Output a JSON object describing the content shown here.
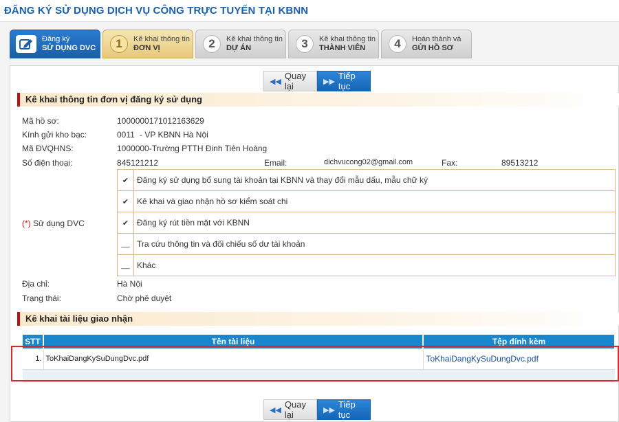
{
  "page": {
    "title": "ĐĂNG KÝ SỬ DỤNG DỊCH VỤ CÔNG TRỰC TUYẾN TẠI KBNN"
  },
  "tabs": [
    {
      "line1": "Đăng ký",
      "line2": "SỬ DỤNG DVC",
      "icon": "edit-icon"
    },
    {
      "number": "1",
      "line1": "Kê khai thông tin",
      "line2": "ĐƠN VỊ"
    },
    {
      "number": "2",
      "line1": "Kê khai thông tin",
      "line2": "DỰ ÁN"
    },
    {
      "number": "3",
      "line1": "Kê khai thông tin",
      "line2": "THÀNH VIÊN"
    },
    {
      "number": "4",
      "line1": "Hoàn thành và",
      "line2": "GỬI HỒ SƠ"
    }
  ],
  "actions": {
    "back_label": "Quay lại",
    "next_label": "Tiếp tục"
  },
  "unit_section": {
    "title": "Kê khai thông tin đơn vị đăng ký sử dụng",
    "ma_ho_so_label": "Mã hồ sơ:",
    "ma_ho_so": "1000000171012163629",
    "kho_bac_label": "Kính gửi kho bạc:",
    "kho_bac_code": "0011",
    "kho_bac_name": "- VP KBNN Hà Nội",
    "dvqhns_label": "Mã ĐVQHNS:",
    "dvqhns": "1000000-Trường PTTH Đinh Tiên Hoàng",
    "phone_label": "Số điện thoại:",
    "phone": "845121212",
    "email_label": "Email:",
    "email": "dichvucong02@gmail.com",
    "fax_label": "Fax:",
    "fax": "89513212",
    "dvc_required": "(*)",
    "dvc_label": "Sử dụng DVC",
    "services": [
      {
        "mark": "✔",
        "label": "Đăng ký sử dụng bổ sung tài khoản tại KBNN và thay đổi mẫu dấu, mẫu chữ ký",
        "checked": true
      },
      {
        "mark": "✔",
        "label": "Kê khai và giao nhận hồ sơ kiểm soát chi",
        "checked": true
      },
      {
        "mark": "✔",
        "label": "Đăng ký rút tiền mặt với KBNN",
        "checked": true
      },
      {
        "mark": "__",
        "label": "Tra cứu thông tin và đối chiếu số dư tài khoản",
        "checked": false
      },
      {
        "mark": "__",
        "label": "Khác",
        "checked": false
      }
    ],
    "address_label": "Địa chỉ:",
    "address": "Hà Nội",
    "status_label": "Trạng thái:",
    "status": "Chờ phê duyệt"
  },
  "docs_section": {
    "title": "Kê khai tài liệu giao nhận",
    "columns": [
      "STT",
      "Tên tài liệu",
      "Tệp đính kèm"
    ],
    "rows": [
      {
        "stt": "1.",
        "name": "ToKhaiDangKySuDungDvc.pdf",
        "file": "ToKhaiDangKySuDungDvc.pdf"
      }
    ]
  },
  "colors": {
    "accent": "#1a86cc",
    "title": "#1a5fa8",
    "highlight": "#d42a2a"
  }
}
